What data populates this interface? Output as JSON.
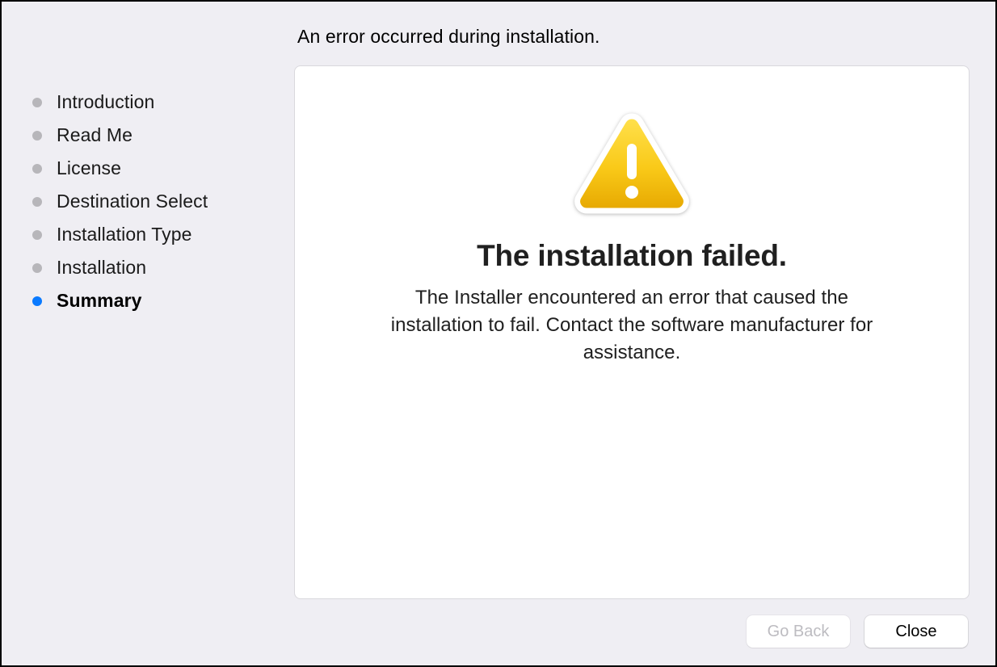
{
  "header": "An error occurred during installation.",
  "sidebar": {
    "steps": [
      {
        "label": "Introduction",
        "active": false
      },
      {
        "label": "Read Me",
        "active": false
      },
      {
        "label": "License",
        "active": false
      },
      {
        "label": "Destination Select",
        "active": false
      },
      {
        "label": "Installation Type",
        "active": false
      },
      {
        "label": "Installation",
        "active": false
      },
      {
        "label": "Summary",
        "active": true
      }
    ]
  },
  "error": {
    "title": "The installation failed.",
    "body": "The Installer encountered an error that caused the installation to fail. Contact the software manufacturer for assistance."
  },
  "buttons": {
    "back": "Go Back",
    "close": "Close"
  }
}
